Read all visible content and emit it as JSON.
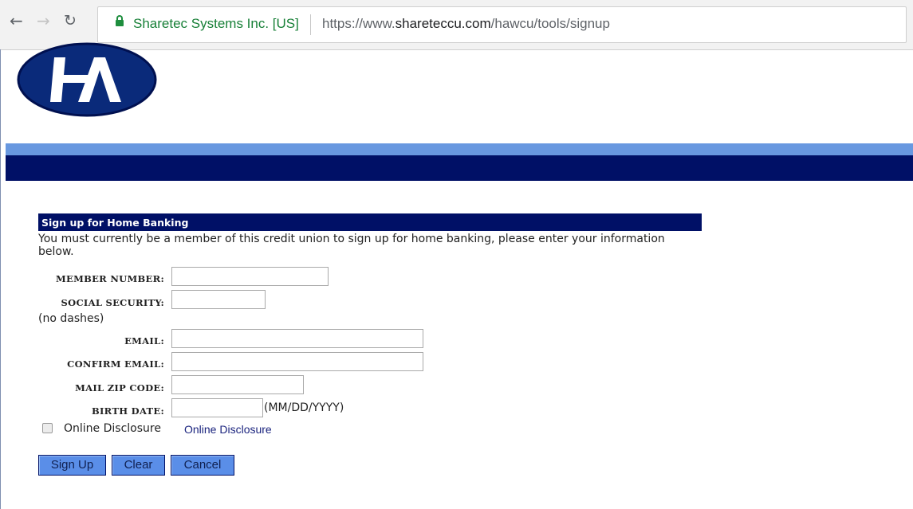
{
  "browser": {
    "site_identity": "Sharetec Systems Inc. [US]",
    "url_prefix": "https://www.",
    "url_host": "shareteccu.com",
    "url_path": "/hawcu/tools/signup"
  },
  "colors": {
    "banner_dark": "#001066",
    "banner_light": "#6898e0",
    "button_bg": "#5a8ee8",
    "secure_green": "#1e8e3e"
  },
  "logo": {
    "text": "HA"
  },
  "form": {
    "title": "Sign up for Home Banking",
    "intro": "You must currently be a member of this credit union to sign up for home banking, please enter your information below.",
    "member_number_label": "MEMBER NUMBER:",
    "member_number_value": "",
    "ssn_label": "SOCIAL SECURITY:",
    "ssn_value": "",
    "ssn_note": "(no dashes)",
    "email_label": "EMAIL:",
    "email_value": "",
    "confirm_email_label": "CONFIRM EMAIL:",
    "confirm_email_value": "",
    "zip_label": "MAIL ZIP CODE:",
    "zip_value": "",
    "birth_label": "BIRTH DATE:",
    "birth_value": "",
    "birth_format": "(MM/DD/YYYY)",
    "disclosure_checkbox_label": "Online Disclosure",
    "disclosure_link": "Online Disclosure",
    "disclosure_checked": false
  },
  "buttons": {
    "signup": "Sign Up",
    "clear": "Clear",
    "cancel": "Cancel"
  }
}
